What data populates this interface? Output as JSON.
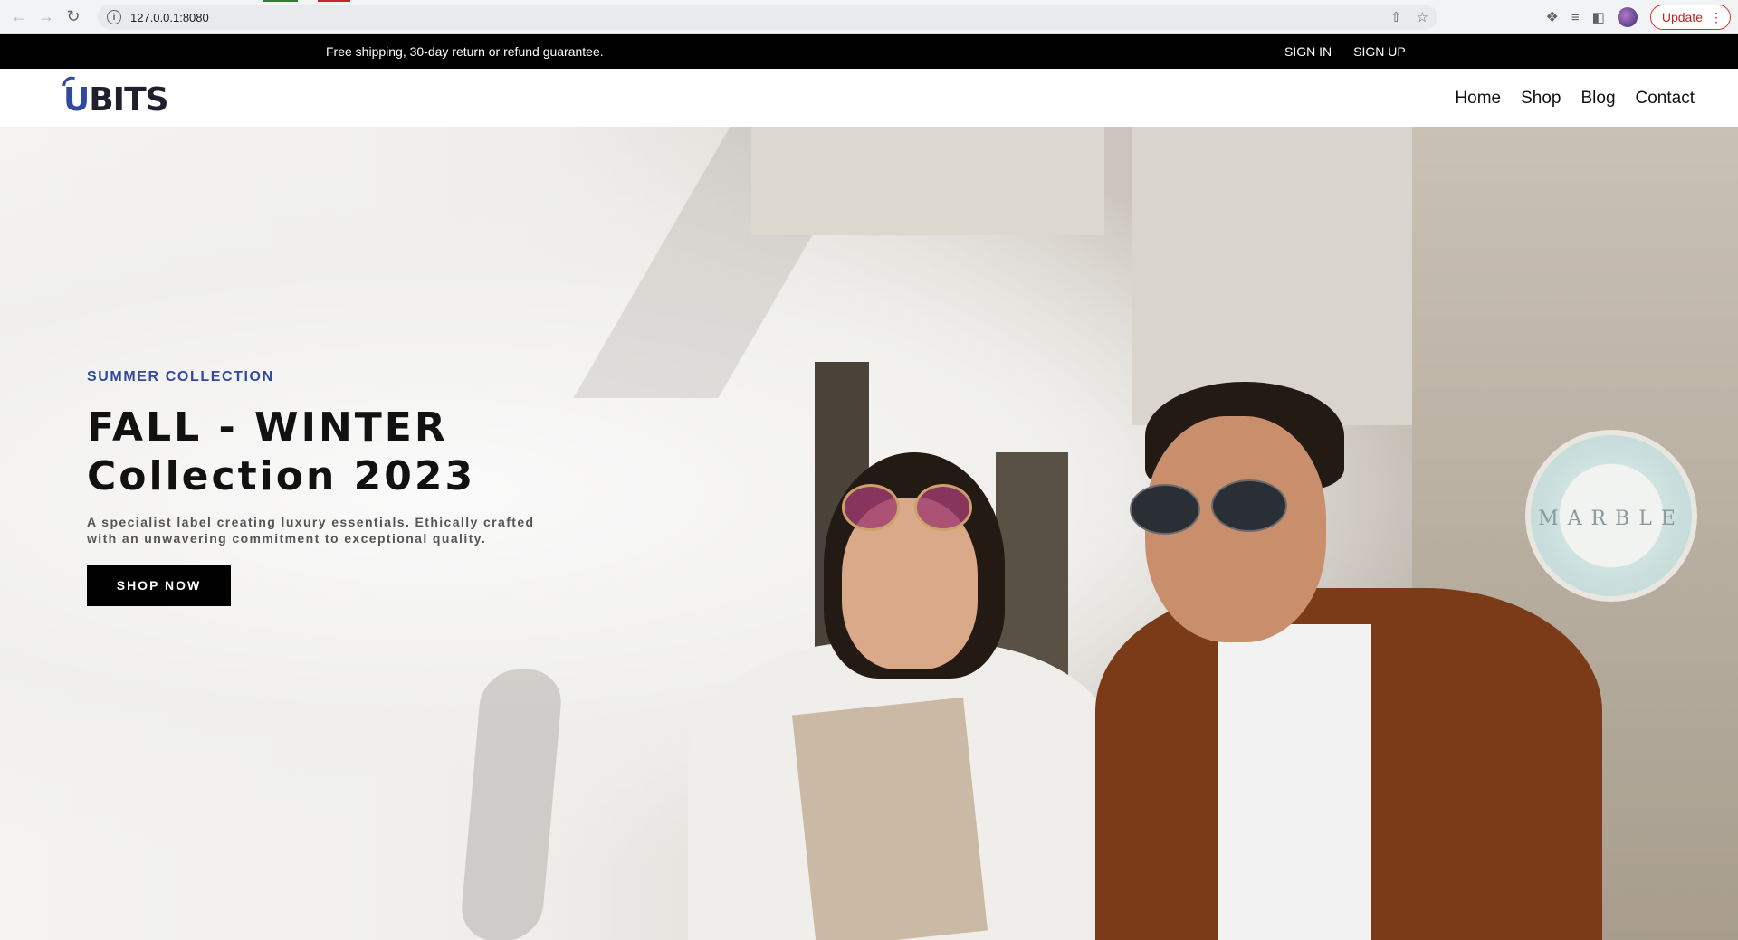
{
  "browser": {
    "url": "127.0.0.1:8080",
    "update_label": "Update"
  },
  "promo": {
    "message": "Free shipping, 30-day return or refund guarantee.",
    "sign_in": "SIGN IN",
    "sign_up": "SIGN UP"
  },
  "header": {
    "logo_u": "U",
    "logo_rest": "BITS",
    "nav": [
      "Home",
      "Shop",
      "Blog",
      "Contact"
    ]
  },
  "hero": {
    "eyebrow": "SUMMER COLLECTION",
    "headline_line1": "FALL - WINTER",
    "headline_line2": "Collection 2023",
    "subtext": "A specialist label creating luxury essentials. Ethically crafted with an unwavering commitment to exceptional quality.",
    "cta": "SHOP NOW",
    "sign_text": "MARBLE",
    "accent_color": "#2f4a9c"
  }
}
